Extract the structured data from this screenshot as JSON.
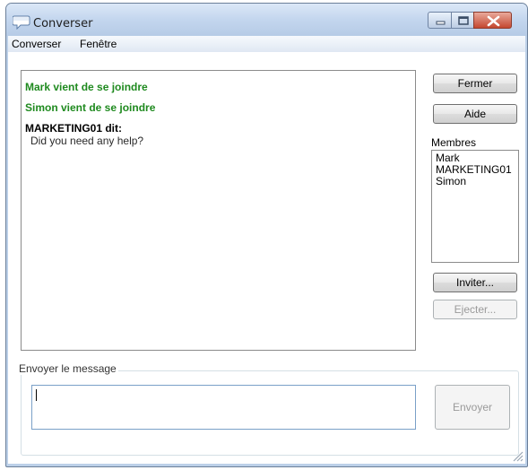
{
  "window": {
    "title": "Converser",
    "icons": {
      "app": "chat-bubble-icon",
      "minimize": "minimize-icon",
      "maximize": "maximize-icon",
      "close": "close-icon"
    }
  },
  "menu": {
    "items": [
      "Converser",
      "Fenêtre"
    ]
  },
  "chat": {
    "lines": [
      {
        "type": "system",
        "text": "Mark vient de se joindre"
      },
      {
        "type": "system",
        "text": "Simon vient de se joindre"
      },
      {
        "type": "speaker",
        "text": "MARKETING01 dit:"
      },
      {
        "type": "message",
        "text": "Did you need any help?"
      }
    ],
    "colors": {
      "system": "#1f8a1f"
    }
  },
  "buttons": {
    "close_label": "Fermer",
    "help_label": "Aide",
    "invite_label": "Inviter...",
    "eject_label": "Ejecter...",
    "send_label": "Envoyer"
  },
  "members": {
    "label": "Membres",
    "items": [
      "Mark",
      "MARKETING01",
      "Simon"
    ]
  },
  "compose": {
    "group_label": "Envoyer le message",
    "value": ""
  }
}
